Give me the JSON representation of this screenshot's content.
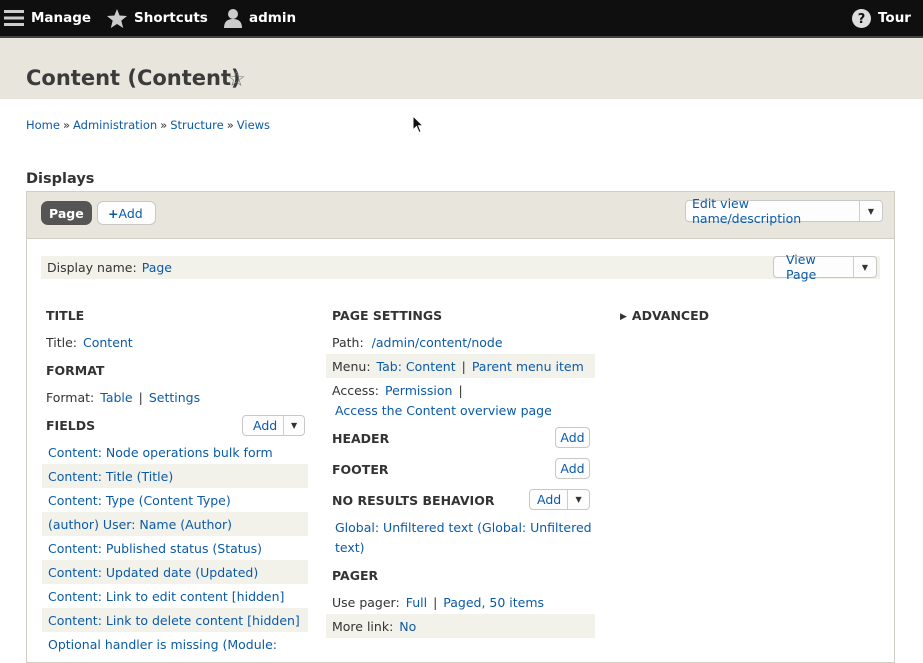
{
  "toolbar": {
    "manage": "Manage",
    "shortcuts": "Shortcuts",
    "user": "admin",
    "tour": "Tour"
  },
  "page": {
    "title": "Content (Content)"
  },
  "breadcrumb": [
    "Home",
    "Administration",
    "Structure",
    "Views"
  ],
  "displays": {
    "heading": "Displays",
    "tab_page": "Page",
    "add_label": "Add",
    "edit_view_label": "Edit view name/description",
    "display_name_label": "Display name:",
    "display_name_value": "Page",
    "view_page_label": "View Page"
  },
  "left": {
    "title_heading": "TITLE",
    "title_label": "Title:",
    "title_value": "Content",
    "format_heading": "FORMAT",
    "format_label": "Format:",
    "format_value": "Table",
    "format_settings": "Settings",
    "fields_heading": "FIELDS",
    "fields_add": "Add",
    "fields": [
      "Content: Node operations bulk form",
      "Content: Title (Title)",
      "Content: Type (Content Type)",
      "(author) User: Name (Author)",
      "Content: Published status (Status)",
      "Content: Updated date (Updated)",
      "Content: Link to edit content [hidden]",
      "Content: Link to delete content [hidden]",
      "Optional handler is missing (Module:"
    ]
  },
  "middle": {
    "page_settings_heading": "PAGE SETTINGS",
    "path_label": "Path:",
    "path_value": "/admin/content/node",
    "menu_label": "Menu:",
    "menu_value": "Tab: Content",
    "menu_parent": "Parent menu item",
    "access_label": "Access:",
    "access_value": "Permission",
    "access_detail": "Access the Content overview page",
    "header_heading": "HEADER",
    "header_add": "Add",
    "footer_heading": "FOOTER",
    "footer_add": "Add",
    "no_results_heading": "NO RESULTS BEHAVIOR",
    "no_results_add": "Add",
    "no_results_line1": "Global: Unfiltered text (Global: Unfiltered",
    "no_results_line2": "text)",
    "pager_heading": "PAGER",
    "use_pager_label": "Use pager:",
    "use_pager_value": "Full",
    "use_pager_detail": "Paged, 50 items",
    "more_link_label": "More link:",
    "more_link_value": "No"
  },
  "right": {
    "advanced_label": "ADVANCED"
  }
}
